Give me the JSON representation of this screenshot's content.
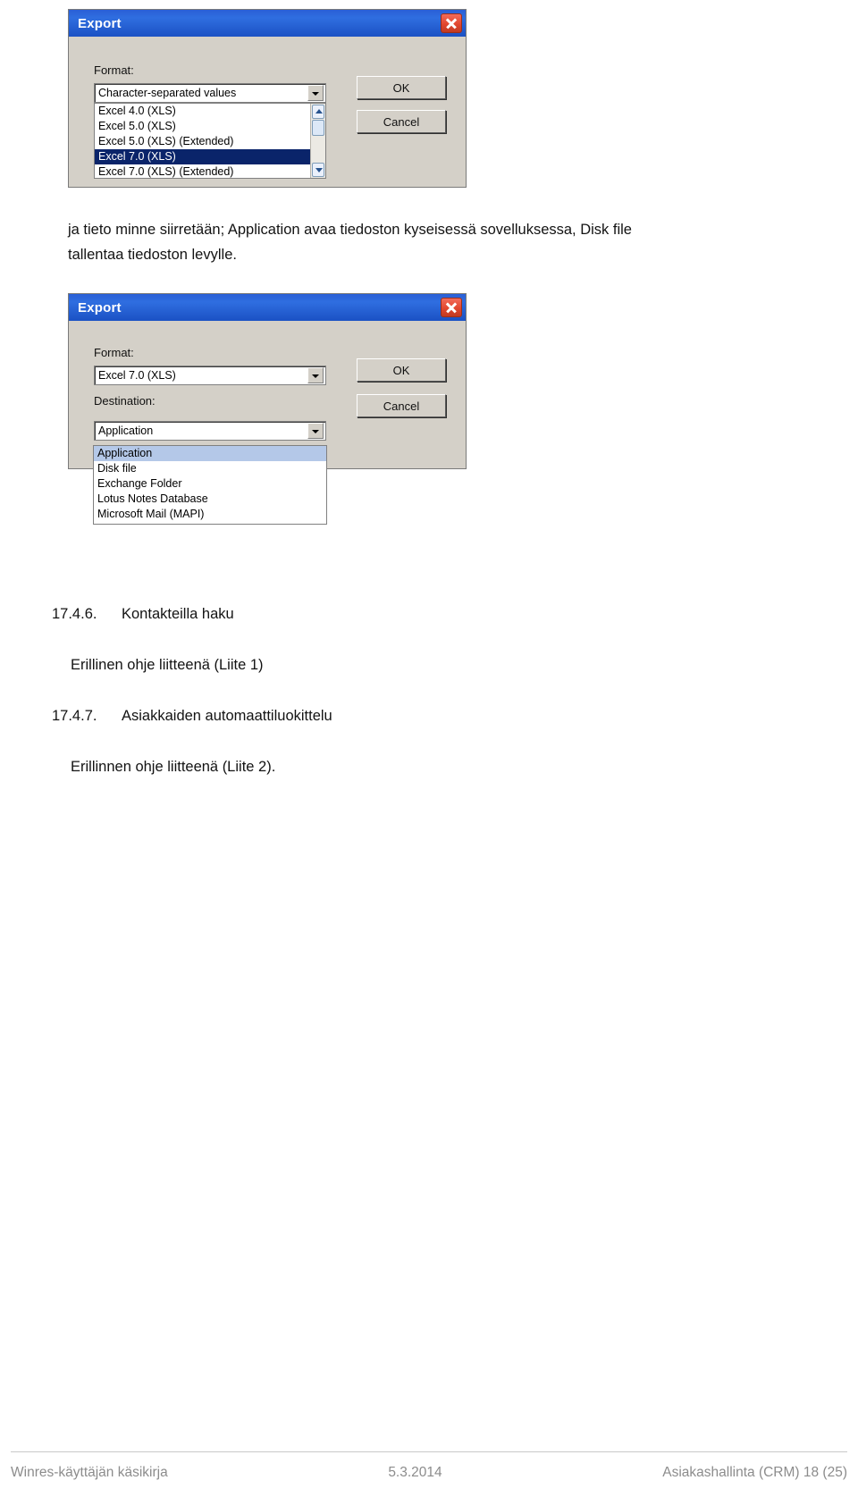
{
  "dialog1": {
    "title": "Export",
    "close_icon": "close-icon",
    "format_label": "Format:",
    "format_value": "Character-separated values",
    "buttons": {
      "ok": "OK",
      "cancel": "Cancel"
    },
    "format_options": [
      "Excel 4.0 (XLS)",
      "Excel 5.0 (XLS)",
      "Excel 5.0 (XLS) (Extended)",
      "Excel 7.0 (XLS)",
      "Excel 7.0 (XLS) (Extended)"
    ],
    "selected_option": "Excel 7.0 (XLS)",
    "scrollbar": {
      "up_icon": "scroll-up-icon",
      "down_icon": "scroll-down-icon"
    }
  },
  "paragraph1": {
    "line1": "ja tieto minne siirretään; Application avaa tiedoston kyseisessä sovelluksessa, Disk file",
    "line2": "tallentaa tiedoston levylle."
  },
  "dialog2": {
    "title": "Export",
    "close_icon": "close-icon",
    "format_label": "Format:",
    "format_value": "Excel 7.0 (XLS)",
    "destination_label": "Destination:",
    "destination_value": "Application",
    "buttons": {
      "ok": "OK",
      "cancel": "Cancel"
    },
    "destination_options": [
      "Application",
      "Disk file",
      "Exchange Folder",
      "Lotus Notes Database",
      "Microsoft Mail (MAPI)"
    ],
    "selected_option": "Application"
  },
  "sections": [
    {
      "number": "17.4.6.",
      "title": "Kontakteilla haku",
      "body": "Erillinen ohje liitteenä (Liite 1)"
    },
    {
      "number": "17.4.7.",
      "title": "Asiakkaiden automaattiluokittelu",
      "body": "Erillinnen ohje liitteenä (Liite 2)."
    }
  ],
  "footer": {
    "left": "Winres-käyttäjän käsikirja",
    "center": "5.3.2014",
    "right": "Asiakashallinta (CRM)  18 (25)"
  }
}
